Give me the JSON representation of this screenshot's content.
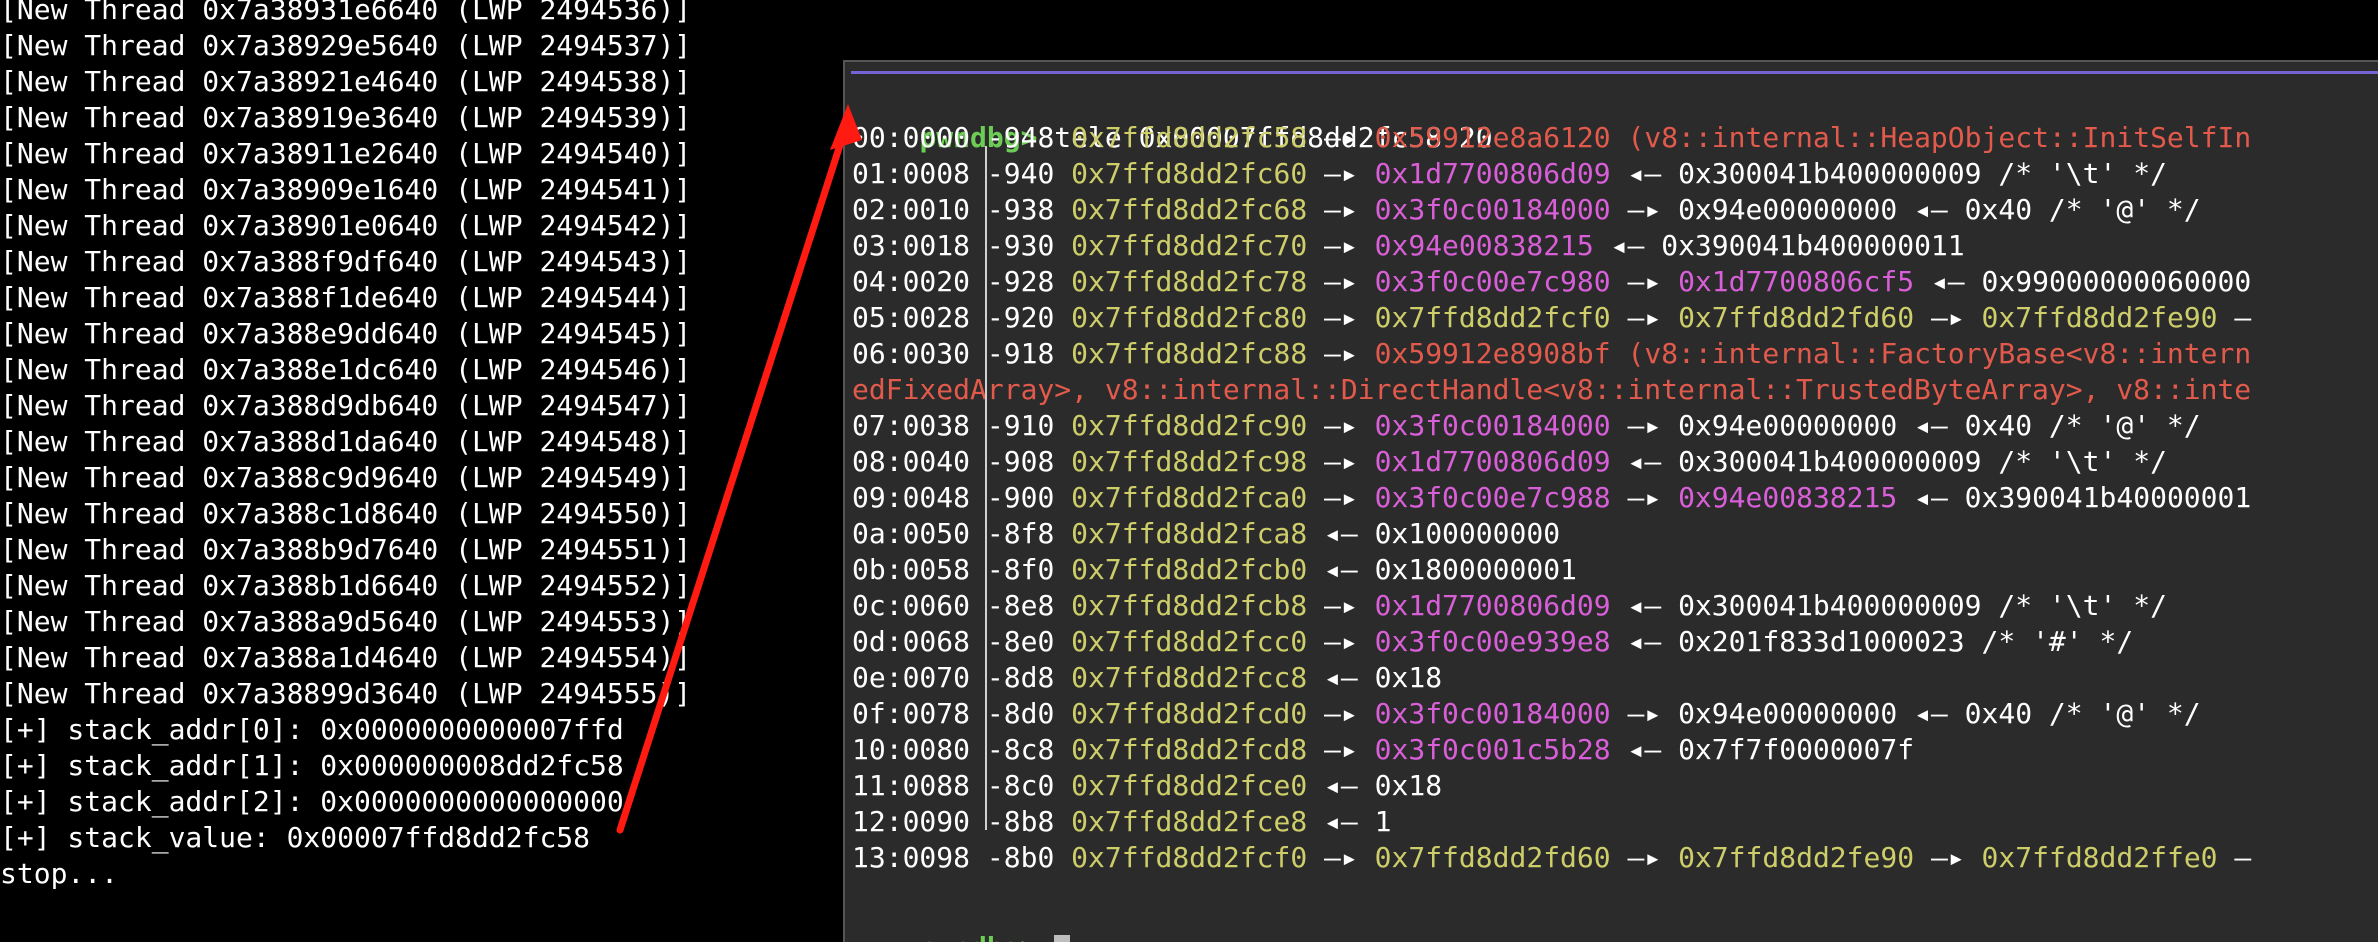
{
  "colors": {
    "white": "#ffffff",
    "yellow": "#cdcd6a",
    "red": "#e25a4c",
    "magenta": "#d85fd8",
    "orange": "#d96a3c",
    "green": "#6dcc56",
    "gray": "#bdbdbd",
    "divider": "#7564d6",
    "annotation": "#ff1a12"
  },
  "left_terminal": {
    "lines": [
      "[New Thread 0x7a38931e6640 (LWP 2494536)]",
      "[New Thread 0x7a38929e5640 (LWP 2494537)]",
      "[New Thread 0x7a38921e4640 (LWP 2494538)]",
      "[New Thread 0x7a38919e3640 (LWP 2494539)]",
      "[New Thread 0x7a38911e2640 (LWP 2494540)]",
      "[New Thread 0x7a38909e1640 (LWP 2494541)]",
      "[New Thread 0x7a38901e0640 (LWP 2494542)]",
      "[New Thread 0x7a388f9df640 (LWP 2494543)]",
      "[New Thread 0x7a388f1de640 (LWP 2494544)]",
      "[New Thread 0x7a388e9dd640 (LWP 2494545)]",
      "[New Thread 0x7a388e1dc640 (LWP 2494546)]",
      "[New Thread 0x7a388d9db640 (LWP 2494547)]",
      "[New Thread 0x7a388d1da640 (LWP 2494548)]",
      "[New Thread 0x7a388c9d9640 (LWP 2494549)]",
      "[New Thread 0x7a388c1d8640 (LWP 2494550)]",
      "[New Thread 0x7a388b9d7640 (LWP 2494551)]",
      "[New Thread 0x7a388b1d6640 (LWP 2494552)]",
      "[New Thread 0x7a388a9d5640 (LWP 2494553)]",
      "[New Thread 0x7a388a1d4640 (LWP 2494554)]",
      "[New Thread 0x7a38899d3640 (LWP 2494555)]",
      "[+] stack_addr[0]: 0x0000000000007ffd",
      "[+] stack_addr[1]: 0x000000008dd2fc58",
      "[+] stack_addr[2]: 0x0000000000000000",
      "[+] stack_value: 0x00007ffd8dd2fc58",
      "stop..."
    ]
  },
  "pwndbg": {
    "prompt": "pwndbg>",
    "command": " tele 0x00007ffd8dd2fc58 20",
    "lines": [
      {
        "segs": [
          {
            "t": "00:0000",
            "c": "white"
          },
          {
            "t": " -948 ",
            "c": "white"
          },
          {
            "t": "0x7ffd8dd2fc58",
            "c": "yellow"
          },
          {
            "t": " —▸ ",
            "c": "white"
          },
          {
            "t": "0x59912e8a6120 (v8::internal::HeapObject::InitSelfIn",
            "c": "red"
          }
        ]
      },
      {
        "segs": [
          {
            "t": "01:0008",
            "c": "white"
          },
          {
            "t": " -940 ",
            "c": "white"
          },
          {
            "t": "0x7ffd8dd2fc60",
            "c": "yellow"
          },
          {
            "t": " —▸ ",
            "c": "white"
          },
          {
            "t": "0x1d7700806d09",
            "c": "magenta"
          },
          {
            "t": " ◂— 0x300041b400000009 /* '\\t' */",
            "c": "white"
          }
        ]
      },
      {
        "segs": [
          {
            "t": "02:0010",
            "c": "white"
          },
          {
            "t": " -938 ",
            "c": "white"
          },
          {
            "t": "0x7ffd8dd2fc68",
            "c": "yellow"
          },
          {
            "t": " —▸ ",
            "c": "white"
          },
          {
            "t": "0x3f0c00184000",
            "c": "magenta"
          },
          {
            "t": " —▸ 0x94e00000000 ◂— 0x40 /* '@' */",
            "c": "white"
          }
        ]
      },
      {
        "segs": [
          {
            "t": "03:0018",
            "c": "white"
          },
          {
            "t": " -930 ",
            "c": "white"
          },
          {
            "t": "0x7ffd8dd2fc70",
            "c": "yellow"
          },
          {
            "t": " —▸ ",
            "c": "white"
          },
          {
            "t": "0x94e00838215",
            "c": "magenta"
          },
          {
            "t": " ◂— 0x390041b400000011",
            "c": "white"
          }
        ]
      },
      {
        "segs": [
          {
            "t": "04:0020",
            "c": "white"
          },
          {
            "t": " -928 ",
            "c": "white"
          },
          {
            "t": "0x7ffd8dd2fc78",
            "c": "yellow"
          },
          {
            "t": " —▸ ",
            "c": "white"
          },
          {
            "t": "0x3f0c00e7c980",
            "c": "magenta"
          },
          {
            "t": " —▸ ",
            "c": "white"
          },
          {
            "t": "0x1d7700806cf5",
            "c": "magenta"
          },
          {
            "t": " ◂— 0x99000000060000",
            "c": "white"
          }
        ]
      },
      {
        "segs": [
          {
            "t": "05:0028",
            "c": "white"
          },
          {
            "t": " -920 ",
            "c": "white"
          },
          {
            "t": "0x7ffd8dd2fc80",
            "c": "yellow"
          },
          {
            "t": " —▸ ",
            "c": "white"
          },
          {
            "t": "0x7ffd8dd2fcf0",
            "c": "yellow"
          },
          {
            "t": " —▸ ",
            "c": "white"
          },
          {
            "t": "0x7ffd8dd2fd60",
            "c": "yellow"
          },
          {
            "t": " —▸ ",
            "c": "white"
          },
          {
            "t": "0x7ffd8dd2fe90",
            "c": "yellow"
          },
          {
            "t": " —",
            "c": "white"
          }
        ]
      },
      {
        "segs": [
          {
            "t": "06:0030",
            "c": "white"
          },
          {
            "t": " -918 ",
            "c": "white"
          },
          {
            "t": "0x7ffd8dd2fc88",
            "c": "yellow"
          },
          {
            "t": " —▸ ",
            "c": "white"
          },
          {
            "t": "0x59912e8908bf (v8::internal::FactoryBase<v8::intern",
            "c": "red"
          }
        ]
      },
      {
        "segs": [
          {
            "t": "edFixedArray>, v8::internal::DirectHandle<v8::internal::TrustedByteArray>, v8::inte",
            "c": "red"
          }
        ]
      },
      {
        "segs": [
          {
            "t": "07:0038",
            "c": "white"
          },
          {
            "t": " -910 ",
            "c": "white"
          },
          {
            "t": "0x7ffd8dd2fc90",
            "c": "yellow"
          },
          {
            "t": " —▸ ",
            "c": "white"
          },
          {
            "t": "0x3f0c00184000",
            "c": "magenta"
          },
          {
            "t": " —▸ 0x94e00000000 ◂— 0x40 /* '@' */",
            "c": "white"
          }
        ]
      },
      {
        "segs": [
          {
            "t": "08:0040",
            "c": "white"
          },
          {
            "t": " -908 ",
            "c": "white"
          },
          {
            "t": "0x7ffd8dd2fc98",
            "c": "yellow"
          },
          {
            "t": " —▸ ",
            "c": "white"
          },
          {
            "t": "0x1d7700806d09",
            "c": "magenta"
          },
          {
            "t": " ◂— 0x300041b400000009 /* '\\t' */",
            "c": "white"
          }
        ]
      },
      {
        "segs": [
          {
            "t": "09:0048",
            "c": "white"
          },
          {
            "t": " -900 ",
            "c": "white"
          },
          {
            "t": "0x7ffd8dd2fca0",
            "c": "yellow"
          },
          {
            "t": " —▸ ",
            "c": "white"
          },
          {
            "t": "0x3f0c00e7c988",
            "c": "magenta"
          },
          {
            "t": " —▸ ",
            "c": "white"
          },
          {
            "t": "0x94e00838215",
            "c": "magenta"
          },
          {
            "t": " ◂— 0x390041b40000001",
            "c": "white"
          }
        ]
      },
      {
        "segs": [
          {
            "t": "0a:0050",
            "c": "white"
          },
          {
            "t": " -8f8 ",
            "c": "white"
          },
          {
            "t": "0x7ffd8dd2fca8",
            "c": "yellow"
          },
          {
            "t": " ◂— 0x100000000",
            "c": "white"
          }
        ]
      },
      {
        "segs": [
          {
            "t": "0b:0058",
            "c": "white"
          },
          {
            "t": " -8f0 ",
            "c": "white"
          },
          {
            "t": "0x7ffd8dd2fcb0",
            "c": "yellow"
          },
          {
            "t": " ◂— 0x1800000001",
            "c": "white"
          }
        ]
      },
      {
        "segs": [
          {
            "t": "0c:0060",
            "c": "white"
          },
          {
            "t": " -8e8 ",
            "c": "white"
          },
          {
            "t": "0x7ffd8dd2fcb8",
            "c": "yellow"
          },
          {
            "t": " —▸ ",
            "c": "white"
          },
          {
            "t": "0x1d7700806d09",
            "c": "magenta"
          },
          {
            "t": " ◂— 0x300041b400000009 /* '\\t' */",
            "c": "white"
          }
        ]
      },
      {
        "segs": [
          {
            "t": "0d:0068",
            "c": "white"
          },
          {
            "t": " -8e0 ",
            "c": "white"
          },
          {
            "t": "0x7ffd8dd2fcc0",
            "c": "yellow"
          },
          {
            "t": " —▸ ",
            "c": "white"
          },
          {
            "t": "0x3f0c00e939e8",
            "c": "magenta"
          },
          {
            "t": " ◂— 0x201f833d1000023 /* '#' */",
            "c": "white"
          }
        ]
      },
      {
        "segs": [
          {
            "t": "0e:0070",
            "c": "white"
          },
          {
            "t": " -8d8 ",
            "c": "white"
          },
          {
            "t": "0x7ffd8dd2fcc8",
            "c": "yellow"
          },
          {
            "t": " ◂— 0x18",
            "c": "white"
          }
        ]
      },
      {
        "segs": [
          {
            "t": "0f:0078",
            "c": "white"
          },
          {
            "t": " -8d0 ",
            "c": "white"
          },
          {
            "t": "0x7ffd8dd2fcd0",
            "c": "yellow"
          },
          {
            "t": " —▸ ",
            "c": "white"
          },
          {
            "t": "0x3f0c00184000",
            "c": "magenta"
          },
          {
            "t": " —▸ 0x94e00000000 ◂— 0x40 /* '@' */",
            "c": "white"
          }
        ]
      },
      {
        "segs": [
          {
            "t": "10:0080",
            "c": "white"
          },
          {
            "t": " -8c8 ",
            "c": "white"
          },
          {
            "t": "0x7ffd8dd2fcd8",
            "c": "yellow"
          },
          {
            "t": " —▸ ",
            "c": "white"
          },
          {
            "t": "0x3f0c001c5b28",
            "c": "magenta"
          },
          {
            "t": " ◂— 0x7f7f0000007f",
            "c": "white"
          }
        ]
      },
      {
        "segs": [
          {
            "t": "11:0088",
            "c": "white"
          },
          {
            "t": " -8c0 ",
            "c": "white"
          },
          {
            "t": "0x7ffd8dd2fce0",
            "c": "yellow"
          },
          {
            "t": " ◂— 0x18",
            "c": "white"
          }
        ]
      },
      {
        "segs": [
          {
            "t": "12:0090",
            "c": "white"
          },
          {
            "t": " -8b8 ",
            "c": "white"
          },
          {
            "t": "0x7ffd8dd2fce8",
            "c": "yellow"
          },
          {
            "t": " ◂— 1",
            "c": "white"
          }
        ]
      },
      {
        "segs": [
          {
            "t": "13:0098",
            "c": "white"
          },
          {
            "t": " -8b0 ",
            "c": "white"
          },
          {
            "t": "0x7ffd8dd2fcf0",
            "c": "yellow"
          },
          {
            "t": " —▸ ",
            "c": "white"
          },
          {
            "t": "0x7ffd8dd2fd60",
            "c": "yellow"
          },
          {
            "t": " —▸ ",
            "c": "white"
          },
          {
            "t": "0x7ffd8dd2fe90",
            "c": "yellow"
          },
          {
            "t": " —▸ ",
            "c": "white"
          },
          {
            "t": "0x7ffd8dd2ffe0",
            "c": "yellow"
          },
          {
            "t": " —",
            "c": "white"
          }
        ]
      }
    ]
  }
}
